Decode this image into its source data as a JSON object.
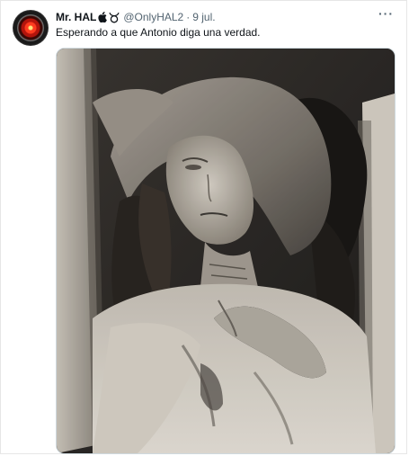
{
  "tweet": {
    "display_name": "Mr. HAL",
    "handle": "@OnlyHAL2",
    "separator": "·",
    "date": "9 jul.",
    "text": "Esperando a que Antonio diga una verdad.",
    "more_label": "···",
    "badge_icons": [
      "apple-icon",
      "taurus-icon"
    ],
    "avatar_icon": "hal9000-eye-icon"
  },
  "media": {
    "subject": "sepia photograph of a mummified woman with a cloth covering her head"
  },
  "colors": {
    "primary_text": "#0f1419",
    "secondary_text": "#536471",
    "border": "#cfd9de"
  }
}
